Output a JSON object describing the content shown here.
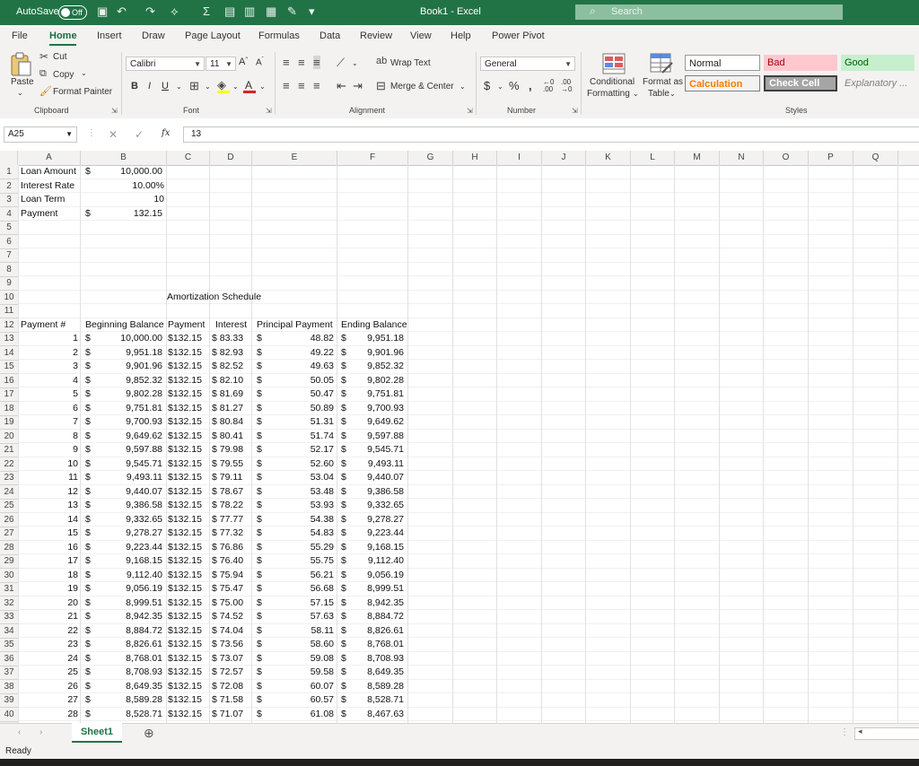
{
  "titlebar": {
    "autosave_label": "AutoSave",
    "autosave_state": "Off",
    "doc_title": "Book1  -  Excel",
    "search_placeholder": "Search"
  },
  "tabs": [
    "File",
    "Home",
    "Insert",
    "Draw",
    "Page Layout",
    "Formulas",
    "Data",
    "Review",
    "View",
    "Help",
    "Power Pivot"
  ],
  "ribbon": {
    "clipboard": {
      "paste": "Paste",
      "cut": "Cut",
      "copy": "Copy",
      "format_painter": "Format Painter",
      "group": "Clipboard"
    },
    "font": {
      "name": "Calibri",
      "size": "11",
      "group": "Font"
    },
    "alignment": {
      "wrap_text": "Wrap Text",
      "merge_center": "Merge & Center",
      "group": "Alignment"
    },
    "number": {
      "format": "General",
      "group": "Number"
    },
    "styles": {
      "conditional": "Conditional",
      "formatting": "Formatting",
      "format_as": "Format as",
      "table": "Table",
      "normal": "Normal",
      "bad": "Bad",
      "good": "Good",
      "calculation": "Calculation",
      "check_cell": "Check Cell",
      "explanatory": "Explanatory ...",
      "group": "Styles"
    }
  },
  "formula_bar": {
    "name_box": "A25",
    "content": "13"
  },
  "columns": [
    "A",
    "B",
    "C",
    "D",
    "E",
    "F",
    "G",
    "H",
    "I",
    "J",
    "K",
    "L",
    "M",
    "N",
    "O",
    "P",
    "Q"
  ],
  "rows": [
    1,
    2,
    3,
    4,
    5,
    6,
    7,
    8,
    9,
    10,
    11,
    12,
    13,
    14,
    15,
    16,
    17,
    18,
    19,
    20,
    21,
    22,
    23,
    24,
    25,
    26,
    27,
    28,
    29,
    30,
    31,
    32,
    33,
    34,
    35,
    36,
    37,
    38,
    39,
    40
  ],
  "summary": {
    "loan_amount_label": "Loan Amount",
    "loan_amount": "10,000.00",
    "interest_rate_label": "Interest Rate",
    "interest_rate": "10.00%",
    "loan_term_label": "Loan Term",
    "loan_term": "10",
    "payment_label": "Payment",
    "payment": "132.15",
    "currency": "$"
  },
  "schedule_title": "Amortization Schedule",
  "headers": [
    "Payment #",
    "Beginning Balance",
    "Payment",
    "Interest",
    "Principal Payment",
    "Ending Balance"
  ],
  "schedule": [
    [
      "1",
      "10,000.00",
      "$132.15",
      "$ 83.33",
      "48.82",
      "9,951.18"
    ],
    [
      "2",
      "9,951.18",
      "$132.15",
      "$ 82.93",
      "49.22",
      "9,901.96"
    ],
    [
      "3",
      "9,901.96",
      "$132.15",
      "$ 82.52",
      "49.63",
      "9,852.32"
    ],
    [
      "4",
      "9,852.32",
      "$132.15",
      "$ 82.10",
      "50.05",
      "9,802.28"
    ],
    [
      "5",
      "9,802.28",
      "$132.15",
      "$ 81.69",
      "50.47",
      "9,751.81"
    ],
    [
      "6",
      "9,751.81",
      "$132.15",
      "$ 81.27",
      "50.89",
      "9,700.93"
    ],
    [
      "7",
      "9,700.93",
      "$132.15",
      "$ 80.84",
      "51.31",
      "9,649.62"
    ],
    [
      "8",
      "9,649.62",
      "$132.15",
      "$ 80.41",
      "51.74",
      "9,597.88"
    ],
    [
      "9",
      "9,597.88",
      "$132.15",
      "$ 79.98",
      "52.17",
      "9,545.71"
    ],
    [
      "10",
      "9,545.71",
      "$132.15",
      "$ 79.55",
      "52.60",
      "9,493.11"
    ],
    [
      "11",
      "9,493.11",
      "$132.15",
      "$ 79.11",
      "53.04",
      "9,440.07"
    ],
    [
      "12",
      "9,440.07",
      "$132.15",
      "$ 78.67",
      "53.48",
      "9,386.58"
    ],
    [
      "13",
      "9,386.58",
      "$132.15",
      "$ 78.22",
      "53.93",
      "9,332.65"
    ],
    [
      "14",
      "9,332.65",
      "$132.15",
      "$ 77.77",
      "54.38",
      "9,278.27"
    ],
    [
      "15",
      "9,278.27",
      "$132.15",
      "$ 77.32",
      "54.83",
      "9,223.44"
    ],
    [
      "16",
      "9,223.44",
      "$132.15",
      "$ 76.86",
      "55.29",
      "9,168.15"
    ],
    [
      "17",
      "9,168.15",
      "$132.15",
      "$ 76.40",
      "55.75",
      "9,112.40"
    ],
    [
      "18",
      "9,112.40",
      "$132.15",
      "$ 75.94",
      "56.21",
      "9,056.19"
    ],
    [
      "19",
      "9,056.19",
      "$132.15",
      "$ 75.47",
      "56.68",
      "8,999.51"
    ],
    [
      "20",
      "8,999.51",
      "$132.15",
      "$ 75.00",
      "57.15",
      "8,942.35"
    ],
    [
      "21",
      "8,942.35",
      "$132.15",
      "$ 74.52",
      "57.63",
      "8,884.72"
    ],
    [
      "22",
      "8,884.72",
      "$132.15",
      "$ 74.04",
      "58.11",
      "8,826.61"
    ],
    [
      "23",
      "8,826.61",
      "$132.15",
      "$ 73.56",
      "58.60",
      "8,768.01"
    ],
    [
      "24",
      "8,768.01",
      "$132.15",
      "$ 73.07",
      "59.08",
      "8,708.93"
    ],
    [
      "25",
      "8,708.93",
      "$132.15",
      "$ 72.57",
      "59.58",
      "8,649.35"
    ],
    [
      "26",
      "8,649.35",
      "$132.15",
      "$ 72.08",
      "60.07",
      "8,589.28"
    ],
    [
      "27",
      "8,589.28",
      "$132.15",
      "$ 71.58",
      "60.57",
      "8,528.71"
    ],
    [
      "28",
      "8,528.71",
      "$132.15",
      "$ 71.07",
      "61.08",
      "8,467.63"
    ]
  ],
  "sheet_tab": "Sheet1",
  "status": "Ready",
  "colors": {
    "excel_green": "#217346",
    "bad_bg": "#ffc7ce",
    "bad_fg": "#9c0006",
    "good_bg": "#c6efce",
    "good_fg": "#006100",
    "calc_fg": "#fa7d00",
    "check_bg": "#a5a5a5"
  }
}
